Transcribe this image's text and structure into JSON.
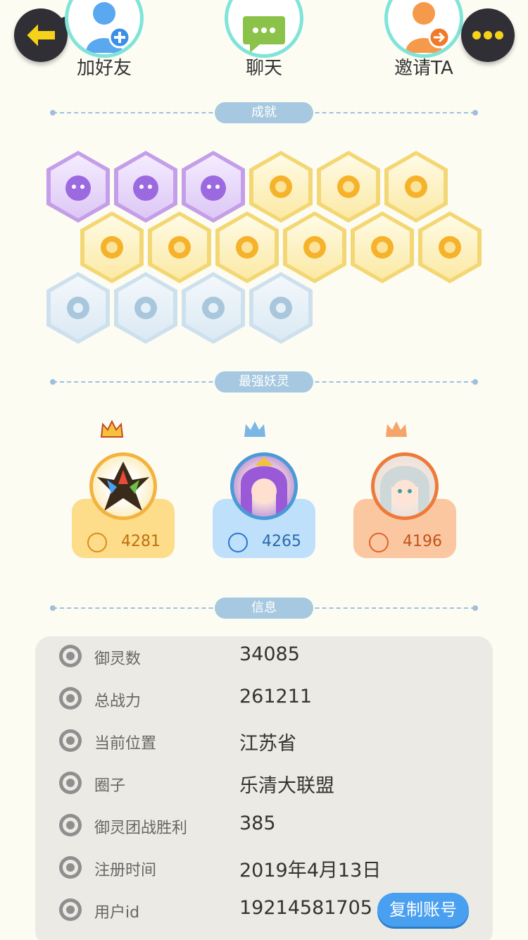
{
  "top_actions": {
    "add_friend": "加好友",
    "chat": "聊天",
    "invite": "邀请TA"
  },
  "sections": {
    "achievements": "成就",
    "strongest": "最强妖灵",
    "info": "信息"
  },
  "achievement_icons": [
    "purple-cat-mask-icon",
    "purple-orb-icon",
    "purple-yin-yang-comet-icon",
    "gold-shoe-icon",
    "gold-sun-flower-icon",
    "gold-moon-sun-icon",
    "gold-crystal-icon",
    "gold-cat-icon",
    "gold-yin-yang-book-icon",
    "gold-fish-icon",
    "gold-fox-silhouette-icon",
    "gold-fox-book-icon",
    "ice-fairy-icon",
    "ice-cart-cat-icon",
    "ice-shield-icon",
    "ice-demon-icon"
  ],
  "strongest": [
    {
      "score": "4281",
      "rank_color": "#f4b23e"
    },
    {
      "score": "4265",
      "rank_color": "#4a9ad8"
    },
    {
      "score": "4196",
      "rank_color": "#ee7a3a"
    }
  ],
  "info": [
    {
      "label": "御灵数",
      "value": "34085",
      "icon": "spirit-icon"
    },
    {
      "label": "总战力",
      "value": "261211",
      "icon": "sword-icon"
    },
    {
      "label": "当前位置",
      "value": "江苏省",
      "icon": "location-pin-icon"
    },
    {
      "label": "圈子",
      "value": "乐清大联盟",
      "icon": "circle-icon"
    },
    {
      "label": "御灵团战胜利",
      "value": "385",
      "icon": "trophy-icon"
    },
    {
      "label": "注册时间",
      "value": "2019年4月13日",
      "icon": "clock-icon"
    },
    {
      "label": "用户id",
      "value": "19214581705",
      "icon": "id-card-icon"
    }
  ],
  "copy_button": "复制账号"
}
